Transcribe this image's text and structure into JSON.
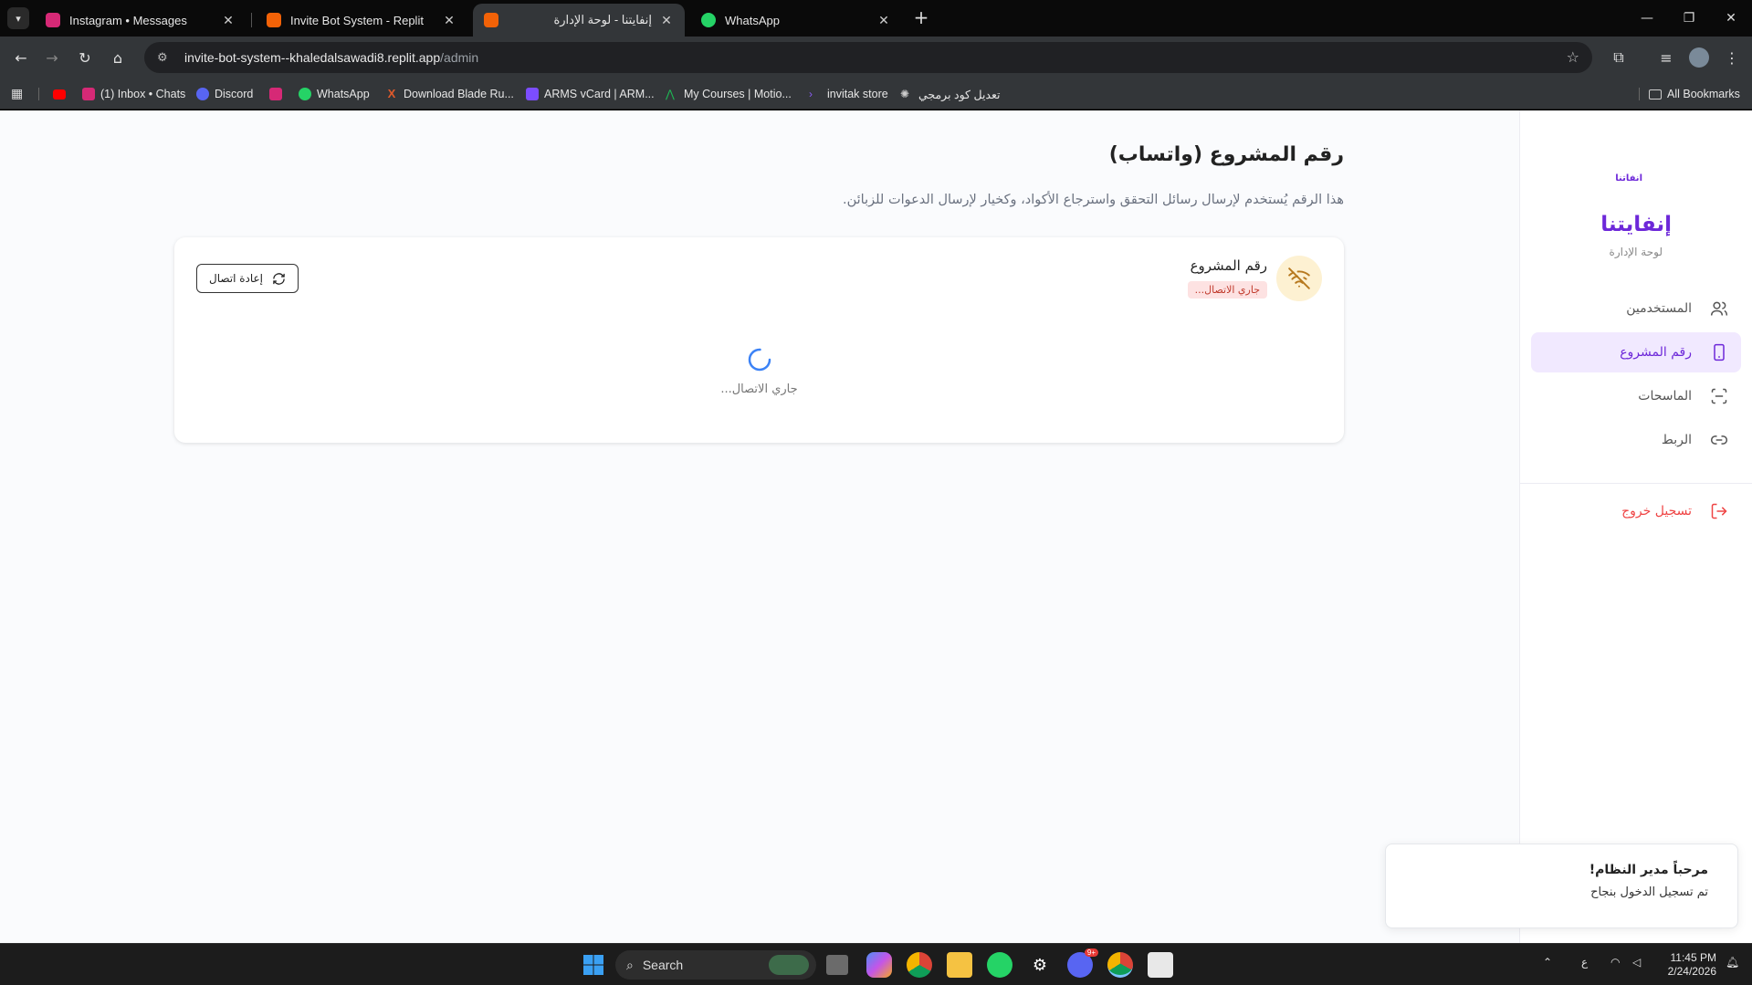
{
  "browser": {
    "tabs": [
      {
        "title": "Instagram • Messages",
        "favicon": "instagram-icon",
        "color": "#d62976"
      },
      {
        "title": "Invite Bot System - Replit",
        "favicon": "replit-icon",
        "color": "#f26207"
      },
      {
        "title": "إنفايتنا - لوحة الإدارة",
        "favicon": "replit-icon",
        "color": "#f26207",
        "active": true
      },
      {
        "title": "WhatsApp",
        "favicon": "whatsapp-icon",
        "color": "#25d366"
      }
    ],
    "url_host": "invite-bot-system--khaledalsawadi8.replit.app",
    "url_path": "/admin",
    "bookmarks": [
      {
        "label": "",
        "icon": "youtube-icon",
        "color": "#ff0000"
      },
      {
        "label": "(1) Inbox • Chats",
        "icon": "instagram-icon",
        "color": "#d62976"
      },
      {
        "label": "Discord",
        "icon": "discord-icon",
        "color": "#5865f2"
      },
      {
        "label": "",
        "icon": "instagram-icon",
        "color": "#d62976"
      },
      {
        "label": "WhatsApp",
        "icon": "whatsapp-icon",
        "color": "#25d366"
      },
      {
        "label": "Download Blade Ru...",
        "icon": "x-icon",
        "color": "#e05a2b"
      },
      {
        "label": "ARMS vCard | ARM...",
        "icon": "pen-icon",
        "color": "#7c4dff"
      },
      {
        "label": "My Courses | Motio...",
        "icon": "chart-icon",
        "color": "#1db954"
      },
      {
        "label": "invitak store",
        "icon": "store-icon",
        "color": "#6d28d9"
      },
      {
        "label": "تعديل كود برمجي",
        "icon": "openai-icon",
        "color": "#cccccc"
      }
    ],
    "all_bookmarks": "All Bookmarks"
  },
  "sidebar": {
    "logo_small": "انفاتنا",
    "brand": "إنفايتنا",
    "subtitle": "لوحة الإدارة",
    "items": [
      {
        "label": "المستخدمين",
        "icon": "users-icon"
      },
      {
        "label": "رقم المشروع",
        "icon": "phone-icon",
        "active": true
      },
      {
        "label": "الماسحات",
        "icon": "scan-icon"
      },
      {
        "label": "الربط",
        "icon": "link-icon"
      }
    ],
    "logout": "تسجيل خروج"
  },
  "main": {
    "title": "رقم المشروع (واتساب)",
    "description": "هذا الرقم يُستخدم لإرسال رسائل التحقق واسترجاع الأكواد، وكخيار لإرسال الدعوات للزبائن.",
    "card": {
      "title": "رقم المشروع",
      "status": "جاري الاتصال...",
      "reconnect": "إعادة اتصال",
      "loading": "جاري الاتصال..."
    }
  },
  "toast": {
    "title": "مرحباً مدير النظام!",
    "message": "تم تسجيل الدخول بنجاح"
  },
  "taskbar": {
    "search": "Search",
    "lang": "ع",
    "time": "11:45 PM",
    "date": "2/24/2026",
    "discord_badge": "9+"
  },
  "colors": {
    "accent": "#6d28d9",
    "active_bg": "#f1e9ff",
    "logout": "#ef4444",
    "status_badge_bg": "#fde2e2",
    "spinner": "#3b82f6"
  }
}
